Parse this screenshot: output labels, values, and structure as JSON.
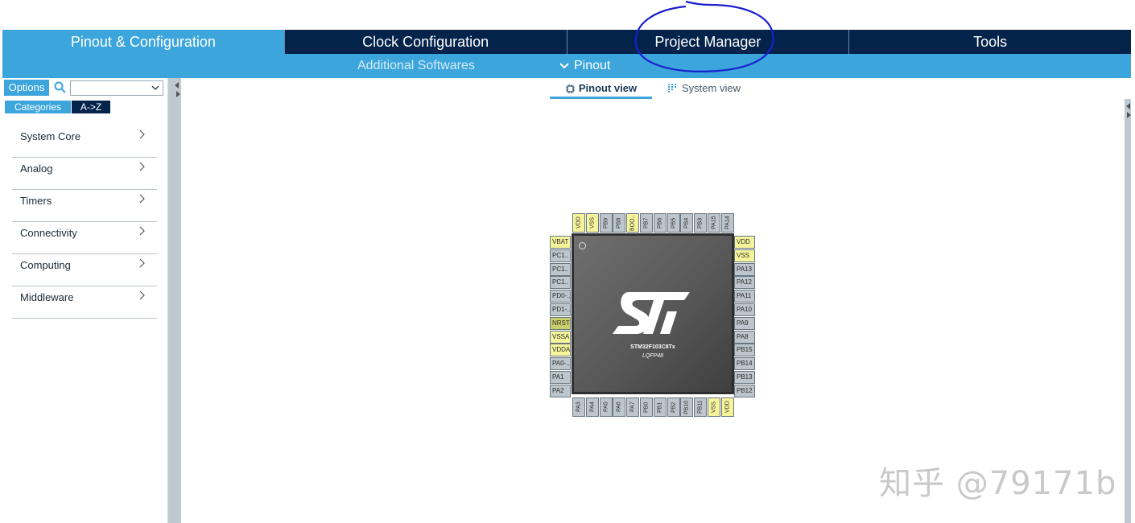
{
  "top_tabs": [
    {
      "label": "Pinout & Configuration",
      "active": true
    },
    {
      "label": "Clock Configuration",
      "active": false
    },
    {
      "label": "Project Manager",
      "active": false
    },
    {
      "label": "Tools",
      "active": false
    }
  ],
  "sub_tabs": {
    "additional": "Additional Softwares",
    "pinout": "Pinout"
  },
  "sidebar": {
    "options_label": "Options",
    "search_value": "",
    "tab_categories": "Categories",
    "tab_az": "A->Z",
    "categories": [
      "System Core",
      "Analog",
      "Timers",
      "Connectivity",
      "Computing",
      "Middleware"
    ]
  },
  "view_tabs": {
    "pinout": "Pinout view",
    "system": "System view"
  },
  "chip": {
    "part_number": "STM32F103C8Tx",
    "package": "LQFP48",
    "logo_text": "ST",
    "pins_top": [
      "VDD",
      "VSS",
      "PB9",
      "PB8",
      "BOO..",
      "PB7",
      "PB6",
      "PB5",
      "PB4",
      "PB3",
      "PA15",
      "PA14"
    ],
    "pins_left": [
      "VBAT",
      "PC1..",
      "PC1..",
      "PC1..",
      "PD0-..",
      "PD1-..",
      "NRST",
      "VSSA",
      "VDDA",
      "PA0-..",
      "PA1",
      "PA2"
    ],
    "pins_right": [
      "VDD",
      "VSS",
      "PA13",
      "PA12",
      "PA11",
      "PA10",
      "PA9",
      "PA8",
      "PB15",
      "PB14",
      "PB13",
      "PB12"
    ],
    "pins_bottom": [
      "PA3",
      "PA4",
      "PA5",
      "PA6",
      "PA7",
      "PB0",
      "PB1",
      "PB2",
      "PB10",
      "PB11",
      "VSS",
      "VDD"
    ]
  },
  "watermark": "知乎 @79171b",
  "colors": {
    "nav_dark": "#03234b",
    "accent": "#3ba5dc",
    "power_pin": "#f6f49a",
    "nrst_pin": "#c9d06b",
    "annotation": "#1a1fcf"
  }
}
